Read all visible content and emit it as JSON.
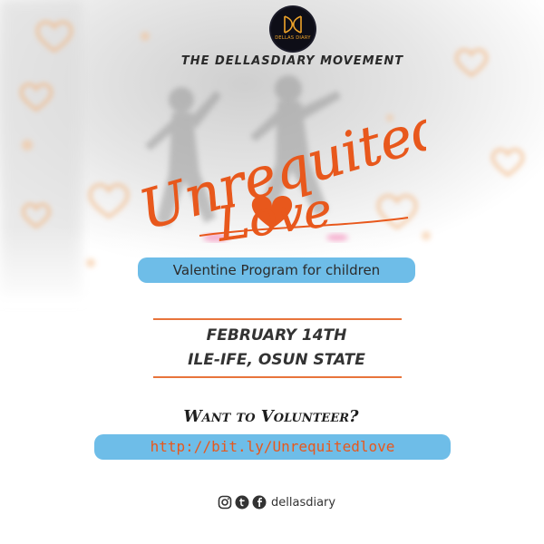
{
  "header": {
    "logo_text": "DELLAS DIARY",
    "movement": "THE DELLASDIARY MOVEMENT"
  },
  "title": {
    "line1": "Unrequited",
    "line2": "Love"
  },
  "program": "Valentine Program for children",
  "event": {
    "date": "FEBRUARY 14TH",
    "location": "ILE-IFE, OSUN STATE"
  },
  "volunteer": {
    "prompt": "Want to Volunteer?",
    "link": "http://bit.ly/Unrequitedlove"
  },
  "social": {
    "icons": [
      "instagram-icon",
      "twitter-icon",
      "facebook-icon"
    ],
    "handle": "dellasdiary"
  },
  "colors": {
    "accent_orange": "#e8581c",
    "pill_blue": "#6ebde8",
    "rule_orange": "#e8743b"
  }
}
